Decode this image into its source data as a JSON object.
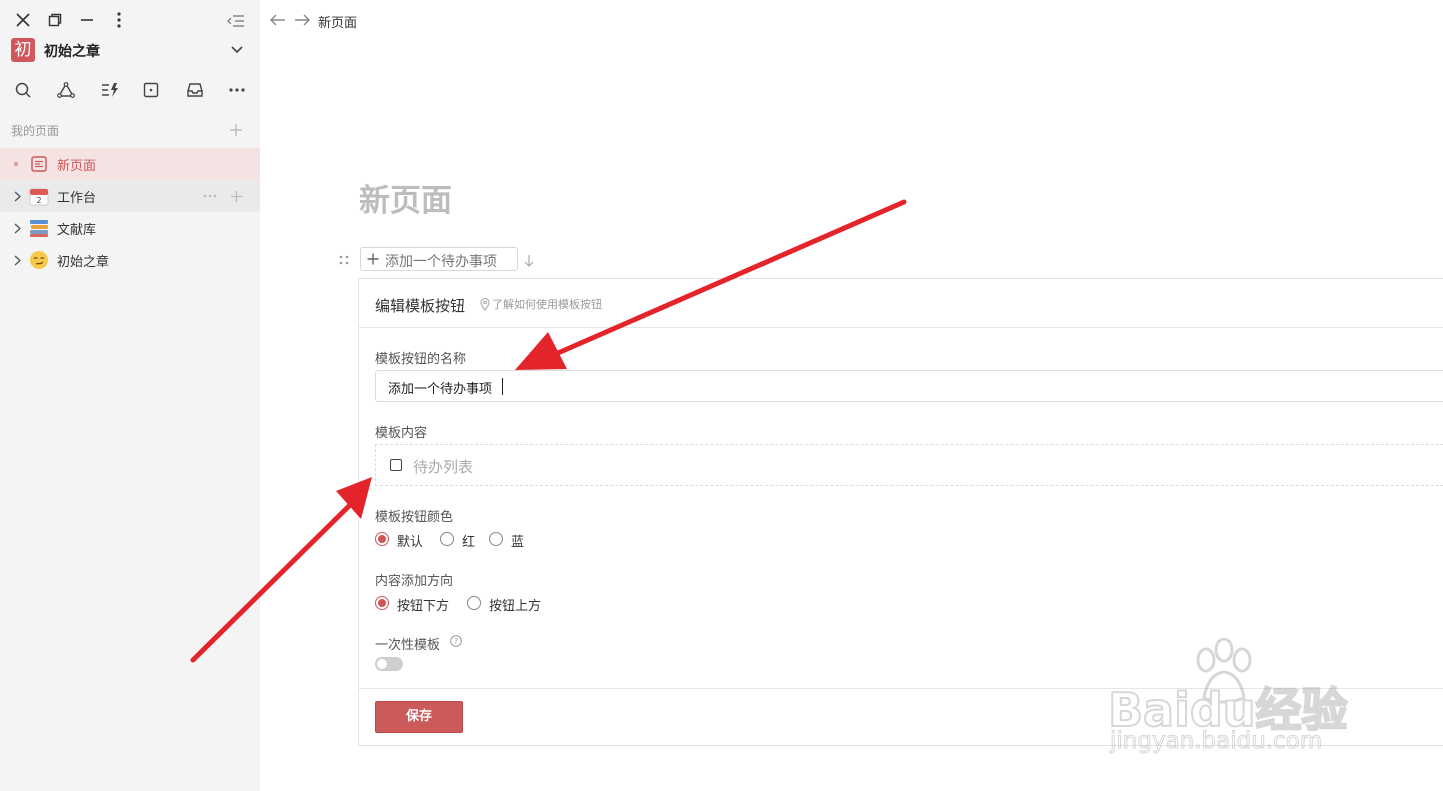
{
  "window": {
    "close_icon": "close-icon",
    "restore_icon": "restore-icon",
    "minimize_icon": "minimize-icon",
    "menu_icon": "more-vertical-icon",
    "collapse_icon": "collapse-sidebar-icon"
  },
  "workspace": {
    "avatar_char": "初",
    "name": "初始之章",
    "accent": "#d0575b"
  },
  "sidebar": {
    "section_title": "我的页面",
    "items": [
      {
        "label": "新页面",
        "active": true
      },
      {
        "label": "工作台"
      },
      {
        "label": "文献库"
      },
      {
        "label": "初始之章"
      }
    ]
  },
  "topbar": {
    "breadcrumb": "新页面"
  },
  "page": {
    "title": "新页面",
    "template_button_label": "添加一个待办事项"
  },
  "panel": {
    "title": "编辑模板按钮",
    "help_link": "了解如何使用模板按钮",
    "name_label": "模板按钮的名称",
    "name_value": "添加一个待办事项",
    "content_label": "模板内容",
    "content_placeholder": "待办列表",
    "color_label": "模板按钮颜色",
    "color_options": [
      "默认",
      "红",
      "蓝"
    ],
    "color_selected": "默认",
    "direction_label": "内容添加方向",
    "direction_options": [
      "按钮下方",
      "按钮上方"
    ],
    "direction_selected": "按钮下方",
    "once_label": "一次性模板",
    "once_enabled": false,
    "save_label": "保存"
  },
  "watermark": {
    "brand": "Baidu经验",
    "url": "jingyan.baidu.com"
  }
}
